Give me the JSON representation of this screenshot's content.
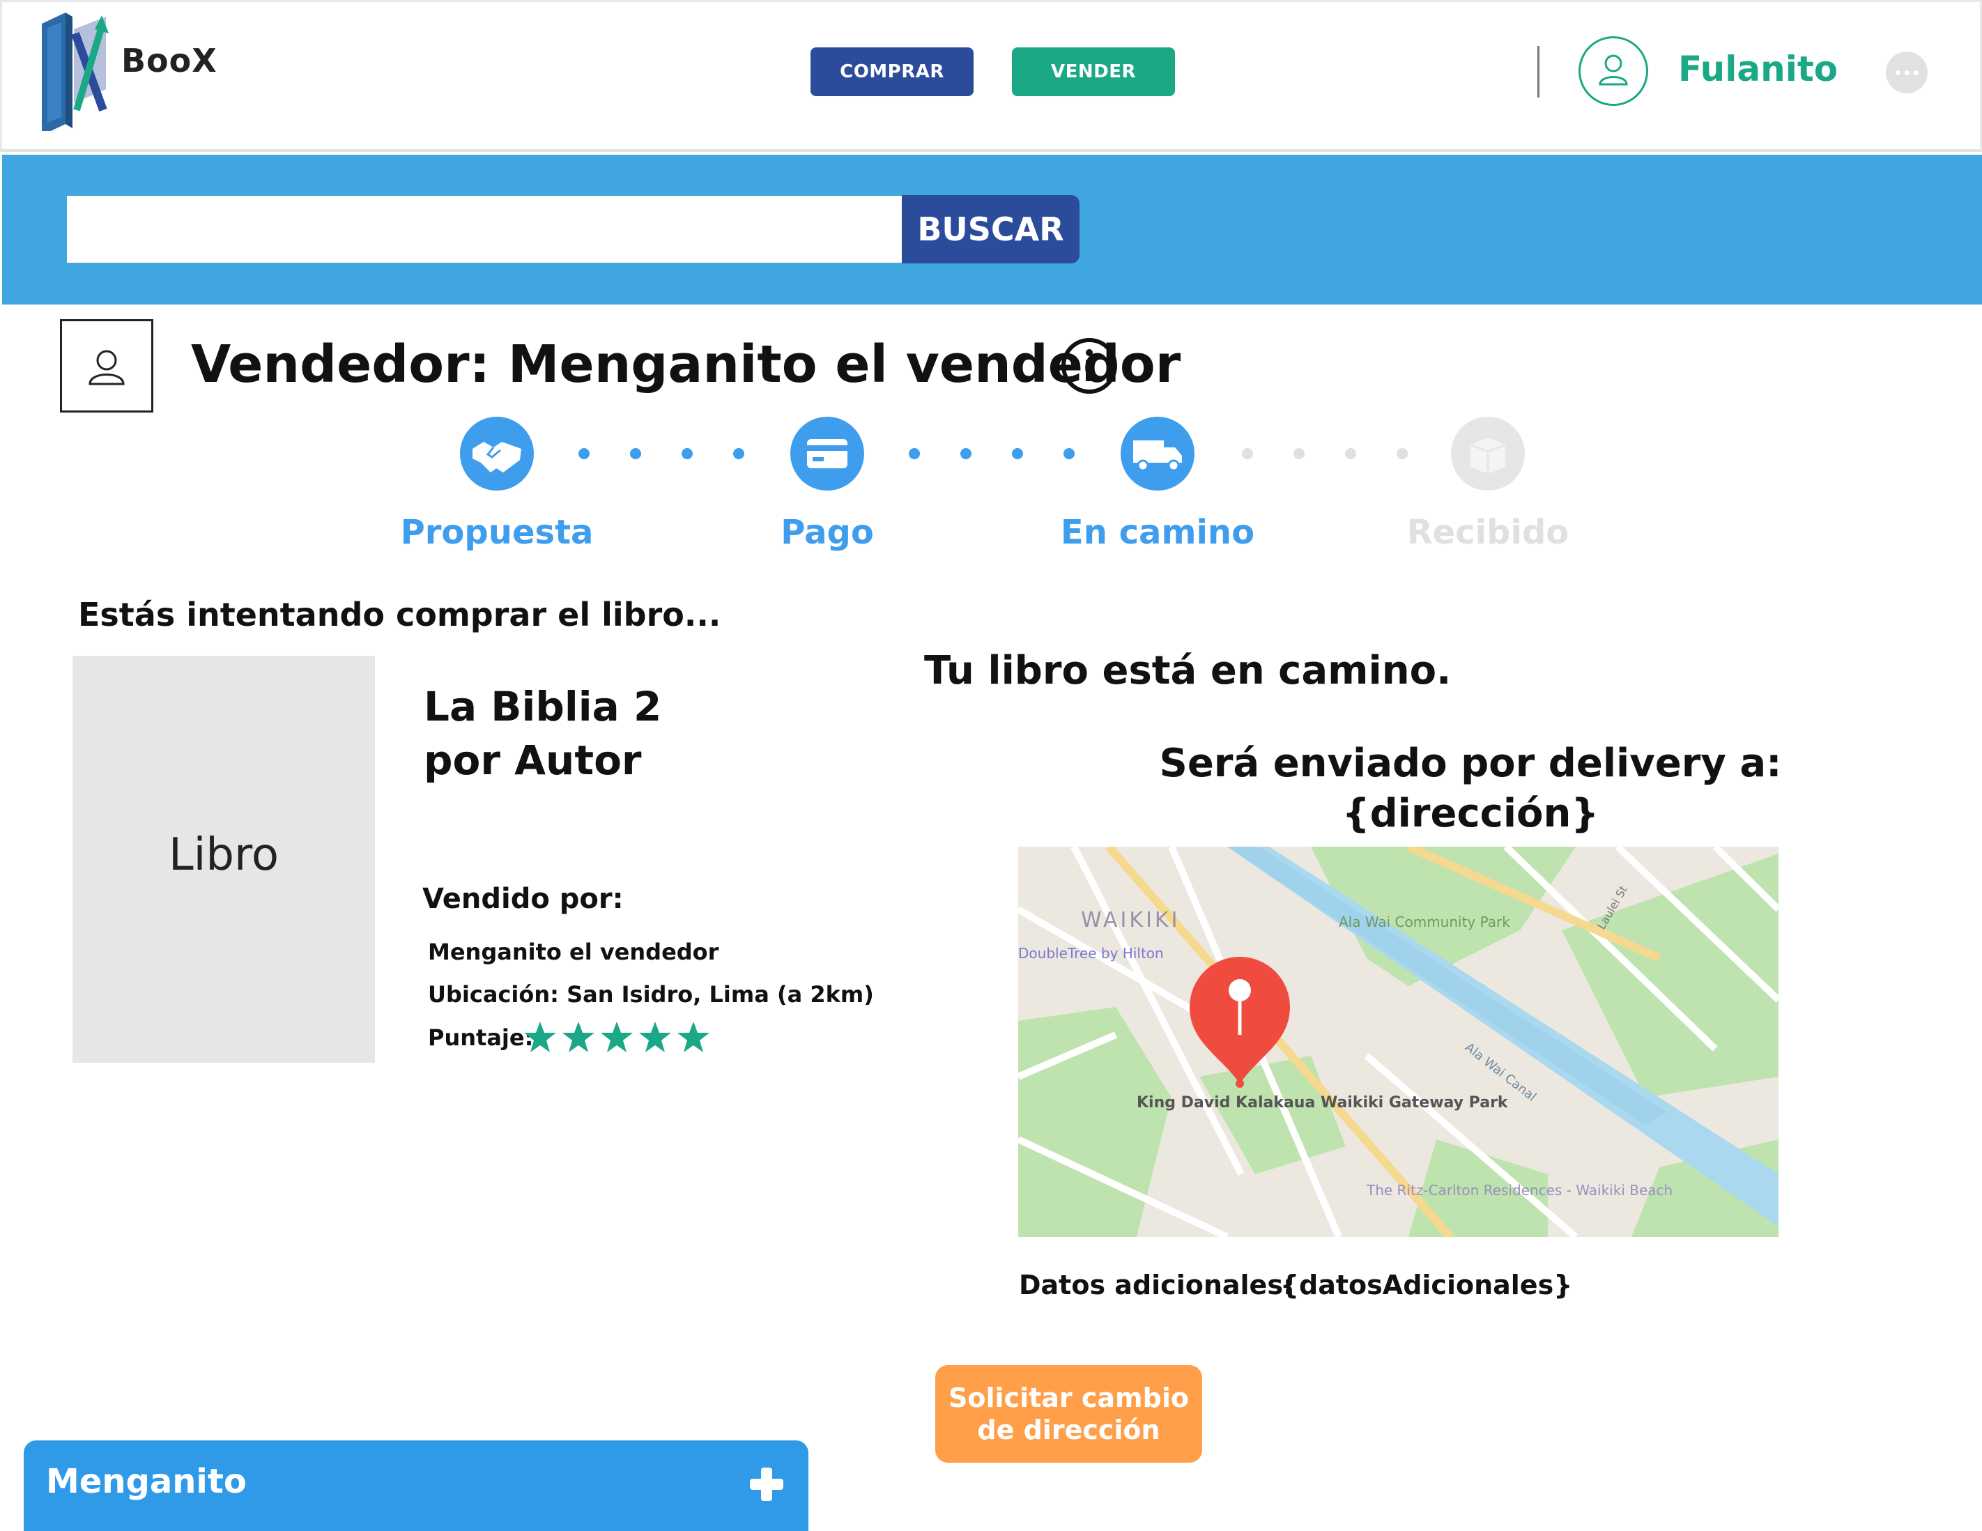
{
  "header": {
    "brand": "BooX",
    "buy_label": "COMPRAR",
    "sell_label": "VENDER",
    "username": "Fulanito"
  },
  "search": {
    "button_label": "BUSCAR",
    "value": "",
    "placeholder": ""
  },
  "seller": {
    "heading": "Vendedor: Menganito el vendedor"
  },
  "stepper": {
    "steps": [
      {
        "label": "Propuesta",
        "icon": "handshake-icon",
        "active": true
      },
      {
        "label": "Pago",
        "icon": "credit-card-icon",
        "active": true
      },
      {
        "label": "En camino",
        "icon": "delivery-truck-icon",
        "active": true
      },
      {
        "label": "Recibido",
        "icon": "package-box-icon",
        "active": false
      }
    ]
  },
  "book": {
    "intro": "Estás intentando comprar el libro...",
    "cover_label": "Libro",
    "title": "La Biblia 2",
    "author": "por Autor",
    "sold_by_label": "Vendido por:",
    "seller_name": "Menganito el vendedor",
    "location": "Ubicación: San Isidro, Lima (a 2km)",
    "rating_label": "Puntaje:",
    "rating": 5,
    "rating_max": 5
  },
  "delivery": {
    "status": "Tu libro está en camino.",
    "line1": "Será enviado por delivery a:",
    "line2": "{dirección}",
    "map_labels": {
      "district": "WAIKIKI",
      "park": "Ala Wai Community Park",
      "hotel": "DoubleTree by Hilton",
      "canal": "Ala Wai Canal",
      "gateway": "King David Kalakaua Waikiki Gateway Park",
      "residences": "The Ritz-Carlton Residences - Waikiki Beach",
      "street": "Laulei St"
    },
    "extra_label": "Datos adicionales:",
    "extra_value": "{datosAdicionales}",
    "change_button": "Solicitar cambio de dirección"
  },
  "chat": {
    "name": "Menganito"
  },
  "colors": {
    "primary_blue": "#2b4b9b",
    "green": "#1ba886",
    "sky_blue": "#40a6e0",
    "step_blue": "#3f9ded",
    "orange": "#ff9f4a",
    "chat_blue": "#2f9be8",
    "inactive_gray": "#e0e0e0"
  }
}
